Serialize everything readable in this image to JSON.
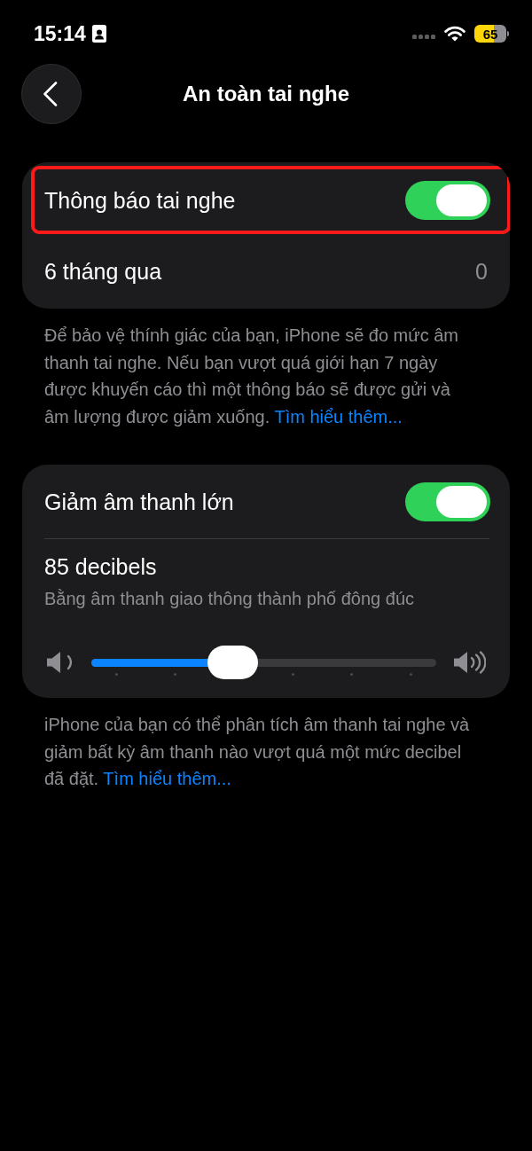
{
  "status_bar": {
    "time": "15:14",
    "battery": "65"
  },
  "header": {
    "title": "An toàn tai nghe"
  },
  "sections": [
    {
      "rows": [
        {
          "kind": "toggle",
          "label": "Thông báo tai nghe",
          "on": true,
          "highlighted": true
        },
        {
          "kind": "value",
          "label": "6 tháng qua",
          "value": "0",
          "highlighted": false
        }
      ],
      "footer": {
        "text": "Để bảo vệ thính giác của bạn, iPhone sẽ đo mức âm thanh tai nghe. Nếu bạn vượt quá giới hạn 7 ngày được khuyến cáo thì một thông báo sẽ được gửi và âm lượng được giảm xuống.",
        "link": "Tìm hiểu thêm..."
      }
    },
    {
      "rows": [
        {
          "kind": "toggle",
          "label": "Giảm âm thanh lớn",
          "on": true,
          "highlighted": false
        },
        {
          "kind": "slider",
          "label": "85 decibels",
          "subtitle": "Bằng âm thanh giao thông thành phố đông đúc",
          "level": 0.41,
          "highlighted": false
        }
      ],
      "footer": {
        "text": "iPhone của bạn có thể phân tích âm thanh tai nghe và giảm bất kỳ âm thanh nào vượt quá một mức decibel đã đặt.",
        "link": "Tìm hiểu thêm..."
      }
    }
  ]
}
